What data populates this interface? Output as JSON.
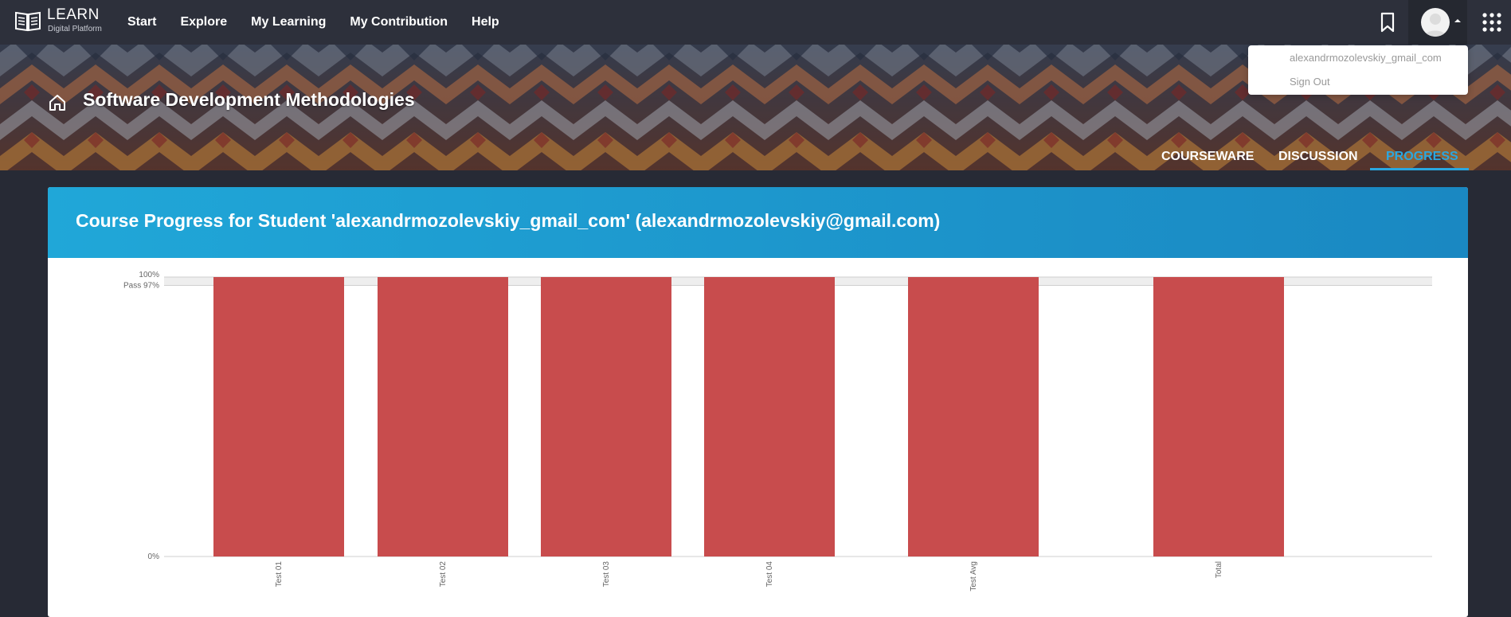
{
  "logo": {
    "title": "LEARN",
    "subtitle": "Digital Platform"
  },
  "nav": {
    "items": [
      "Start",
      "Explore",
      "My Learning",
      "My Contribution",
      "Help"
    ]
  },
  "user_menu": {
    "username": "alexandrmozolevskiy_gmail_com",
    "sign_out": "Sign Out"
  },
  "course": {
    "title": "Software Development Methodologies",
    "tabs": [
      "COURSEWARE",
      "DISCUSSION",
      "PROGRESS"
    ],
    "active_tab": "PROGRESS"
  },
  "progress": {
    "title": "Course Progress for Student 'alexandrmozolevskiy_gmail_com' (alexandrmozolevskiy@gmail.com)"
  },
  "colors": {
    "accent": "#2aa7e0",
    "bar": "#c84c4d",
    "header": "#1a95cc"
  },
  "chart_data": {
    "type": "bar",
    "categories": [
      "Test 01",
      "Test 02",
      "Test 03",
      "Test 04",
      "Test Avg",
      "Total"
    ],
    "values": [
      100,
      100,
      100,
      100,
      100,
      100
    ],
    "ylim": [
      0,
      100
    ],
    "y_ticks": [
      {
        "value": 100,
        "label": "100%"
      },
      {
        "value": 97,
        "label": "Pass 97%"
      },
      {
        "value": 0,
        "label": "0%"
      }
    ],
    "grid": true
  }
}
